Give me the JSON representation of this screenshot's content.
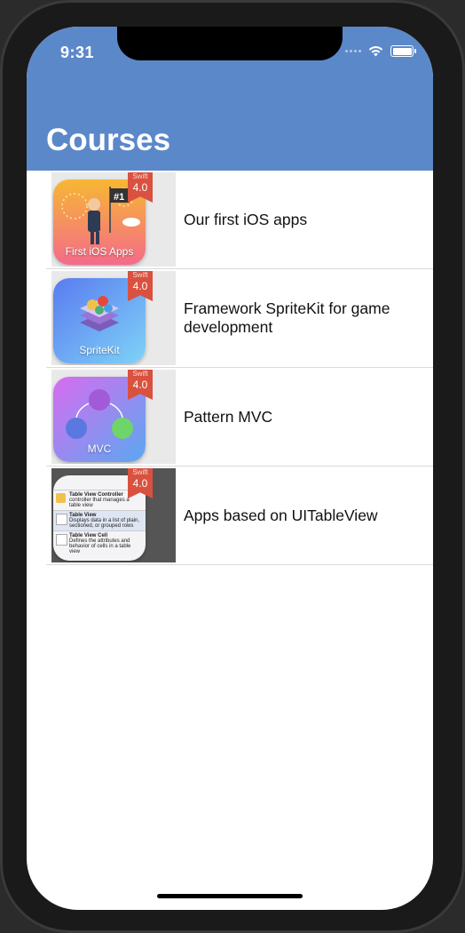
{
  "status": {
    "time": "9:31"
  },
  "nav": {
    "title": "Courses"
  },
  "courses": [
    {
      "title": "Our first iOS apps",
      "icon_label": "First iOS Apps",
      "badge_top": "Swift",
      "badge_version": "4.0"
    },
    {
      "title": "Framework SpriteKit for game development",
      "icon_label": "SpriteKit",
      "badge_top": "Swift",
      "badge_version": "4.0"
    },
    {
      "title": "Pattern MVC",
      "icon_label": "MVC",
      "badge_top": "Swift",
      "badge_version": "4.0"
    },
    {
      "title": "Apps based on UITableView",
      "icon_label": "",
      "badge_top": "Swift",
      "badge_version": "4.0",
      "preview_lines": [
        {
          "name": "Table View Controller",
          "desc": "controller that manages a table view"
        },
        {
          "name": "Table View",
          "desc": "Displays data in a list of plain, sectioned, or grouped rows"
        },
        {
          "name": "Table View Cell",
          "desc": "Defines the attributes and behavior of cells in a table view"
        }
      ]
    }
  ],
  "colors": {
    "navbar": "#5b88c9",
    "ribbon": "#d9513f"
  }
}
